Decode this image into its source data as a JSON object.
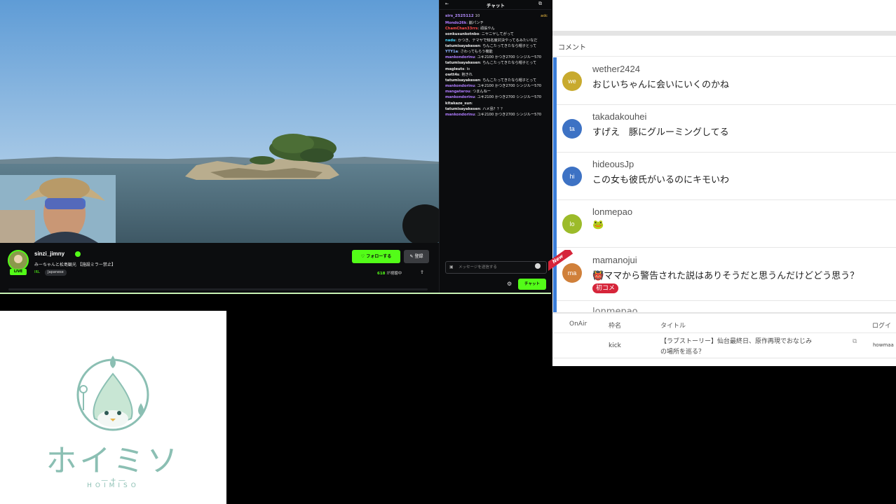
{
  "stream": {
    "streamer": "sinzi_jimny",
    "live_label": "LIVE",
    "title": "みーちゃんと松島観光 【施設ミラー禁止】",
    "language_flag": "IRL",
    "language": "Japanese",
    "follow_label": "♡ フォローする",
    "subscribe_label": "✎ 登録",
    "viewer_count": "618",
    "viewer_suffix": "が視聴中"
  },
  "chat": {
    "title": "チャット",
    "pinned_user": "sirs_2525112",
    "pinned_tail": "10",
    "pinned_right": "adc",
    "messages": [
      {
        "user": "Mondo26k",
        "color": "#b07cff",
        "text": "崩パンチ"
      },
      {
        "user": "ChamChan33rrs",
        "color": "#ff4b4b",
        "text": "頑張やん"
      },
      {
        "user": "sonkusunkotnbo",
        "color": "#e8e8e8",
        "text": "ニヤニヤしてがって"
      },
      {
        "user": "nadu",
        "color": "#45d7ff",
        "text": "かつき、テマヤで知名度対決やってるみたいなだ"
      },
      {
        "user": "tatumisayakesen",
        "color": "#e8e8e8",
        "text": "ちんこたってきたなら帽子とって"
      },
      {
        "user": "YTY1a",
        "color": "#8cb4ff",
        "text": "さわってもらう機能"
      },
      {
        "user": "mankondorinu",
        "color": "#b07cff",
        "text": "ユキ2100 かつき2700 シンジルー570"
      },
      {
        "user": "tatumisayakesen",
        "color": "#e8e8e8",
        "text": "ちんこたってきたなら帽子とって"
      },
      {
        "user": "magleuts",
        "color": "#e8e8e8",
        "text": "lo"
      },
      {
        "user": "owtt4s",
        "color": "#e8e8e8",
        "text": "抱きれ"
      },
      {
        "user": "tatumisayakesen",
        "color": "#e8e8e8",
        "text": "ちんこたってきたなら帽子とって"
      },
      {
        "user": "mankondorinu",
        "color": "#b07cff",
        "text": "ユキ2100 かつき2700 シンジルー570"
      },
      {
        "user": "mangatarou",
        "color": "#b07cff",
        "text": "つまんねー"
      },
      {
        "user": "mankondorinu",
        "color": "#b07cff",
        "text": "ユキ2100 かつき2700 シンジルー570"
      },
      {
        "user": "kitakaze_sun",
        "color": "#e8e8e8",
        "text": ""
      },
      {
        "user": "tatumisayakesen",
        "color": "#e8e8e8",
        "text": "ハメ島？？？"
      },
      {
        "user": "mankondorinu",
        "color": "#b07cff",
        "text": "ユキ2100 かつき2700 シンジルー570"
      }
    ],
    "input_placeholder": "メッセージを送信する",
    "send_label": "チャット"
  },
  "comments": {
    "heading": "コメント",
    "new_label": "New",
    "items": [
      {
        "initials": "we",
        "name": "wether2424",
        "text": "おじいちゃんに会いにいくのかね",
        "color": "#c8aa2e"
      },
      {
        "initials": "ta",
        "name": "takadakouhei",
        "text": "すげえ　豚にグルーミングしてる",
        "color": "#3d72c4"
      },
      {
        "initials": "hi",
        "name": "hideousJp",
        "text": "この女も彼氏がいるのにキモいわ",
        "color": "#3d72c4"
      },
      {
        "initials": "lo",
        "name": "lonmepao",
        "text": "🐸",
        "color": "#9cbb2a"
      },
      {
        "initials": "ma",
        "name": "mamanojui",
        "text": "👹ママから警告された説はありそうだと思うんだけどどう思う？",
        "color": "#d0803a"
      }
    ],
    "first_comment_badge": "初コメ",
    "cut_off_name": "lonmepao"
  },
  "broadcasts": {
    "headers": {
      "onair": "OnAir",
      "name": "枠名",
      "title": "タイトル",
      "log": "ログイ"
    },
    "row": {
      "name": "kick",
      "title_line1": "【ラブストーリー】仙台最終日、原作再現でおなじみ",
      "title_line2": "の場所を巡る？",
      "log": "howmaa"
    }
  },
  "logo": {
    "kana": "ホイミソ",
    "latin": "HOIMISO",
    "color": "#8bbfb3"
  },
  "colors": {
    "kick_green": "#53fc18",
    "accent_blue": "#3b7dd8",
    "badge_red": "#d6253a"
  }
}
